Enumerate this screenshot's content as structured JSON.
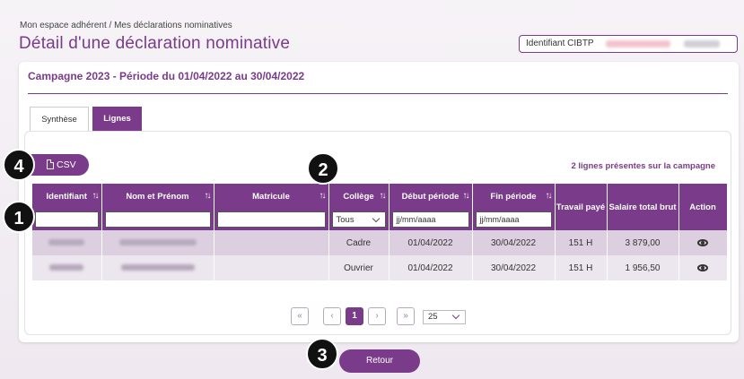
{
  "breadcrumb": "Mon espace adhérent / Mes déclarations nominatives",
  "page_title": "Détail d'une déclaration nominative",
  "cibtp_label": "Identifiant CIBTP",
  "campaign": "Campagne 2023 - Période du 01/04/2022 au 30/04/2022",
  "tabs": {
    "synthese": "Synthèse",
    "lignes": "Lignes"
  },
  "csv_label": "CSV",
  "lines_count": "2 lignes présentes sur la campagne",
  "badges": [
    "4",
    "1",
    "2",
    "3"
  ],
  "table": {
    "headers": {
      "identifiant": "Identifiant",
      "nom": "Nom et Prénom",
      "matricule": "Matricule",
      "college": "Collège",
      "debut": "Début période",
      "fin": "Fin période",
      "travail": "Travail payé",
      "salaire": "Salaire total brut",
      "action": "Action"
    },
    "filters": {
      "college_value": "Tous",
      "debut_placeholder": "jj/mm/aaaa",
      "fin_placeholder": "jj/mm/aaaa"
    },
    "rows": [
      {
        "college": "Cadre",
        "debut": "01/04/2022",
        "fin": "30/04/2022",
        "travail": "151 H",
        "salaire": "3 879,00"
      },
      {
        "college": "Ouvrier",
        "debut": "01/04/2022",
        "fin": "30/04/2022",
        "travail": "151 H",
        "salaire": "1 956,50"
      }
    ]
  },
  "pagination": {
    "first": "«",
    "prev": "‹",
    "current": "1",
    "next": "›",
    "last": "»",
    "page_size": "25"
  },
  "retour_label": "Retour",
  "colors": {
    "accent": "#7a3b8a",
    "row_a": "#dcd0e0",
    "row_b": "#ece6ee"
  }
}
